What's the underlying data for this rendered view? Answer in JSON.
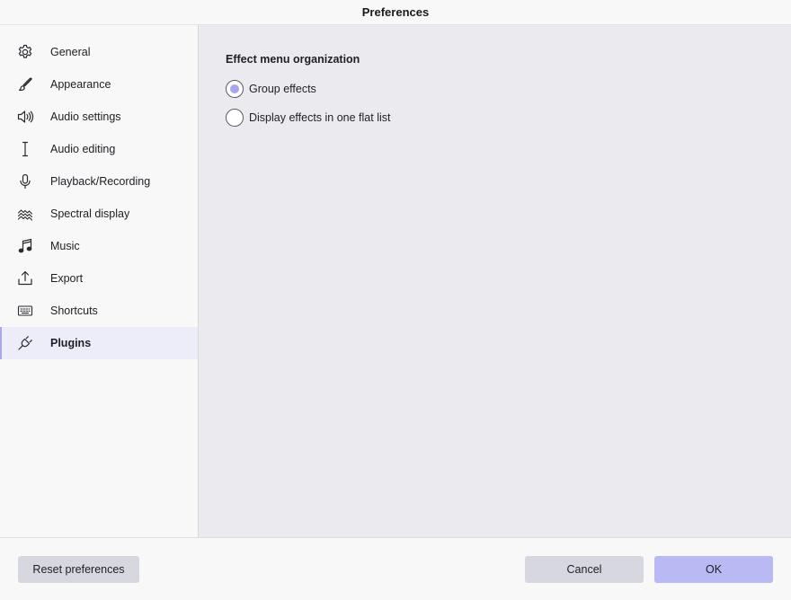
{
  "window": {
    "title": "Preferences"
  },
  "sidebar": {
    "items": [
      {
        "label": "General",
        "icon": "gear-icon"
      },
      {
        "label": "Appearance",
        "icon": "brush-icon"
      },
      {
        "label": "Audio settings",
        "icon": "speaker-icon"
      },
      {
        "label": "Audio editing",
        "icon": "text-cursor-icon"
      },
      {
        "label": "Playback/Recording",
        "icon": "microphone-icon"
      },
      {
        "label": "Spectral display",
        "icon": "spectral-icon"
      },
      {
        "label": "Music",
        "icon": "music-note-icon"
      },
      {
        "label": "Export",
        "icon": "export-icon"
      },
      {
        "label": "Shortcuts",
        "icon": "keyboard-icon"
      },
      {
        "label": "Plugins",
        "icon": "plug-icon",
        "active": true
      }
    ]
  },
  "main": {
    "section_title": "Effect menu organization",
    "options": [
      {
        "label": "Group effects",
        "selected": true
      },
      {
        "label": "Display effects in one flat list",
        "selected": false
      }
    ]
  },
  "footer": {
    "reset_label": "Reset preferences",
    "cancel_label": "Cancel",
    "ok_label": "OK"
  },
  "colors": {
    "accent": "#a6a6ee",
    "ok_button": "#b9b9f3",
    "active_item_bg": "#ededfa",
    "content_bg": "#ebebef"
  }
}
